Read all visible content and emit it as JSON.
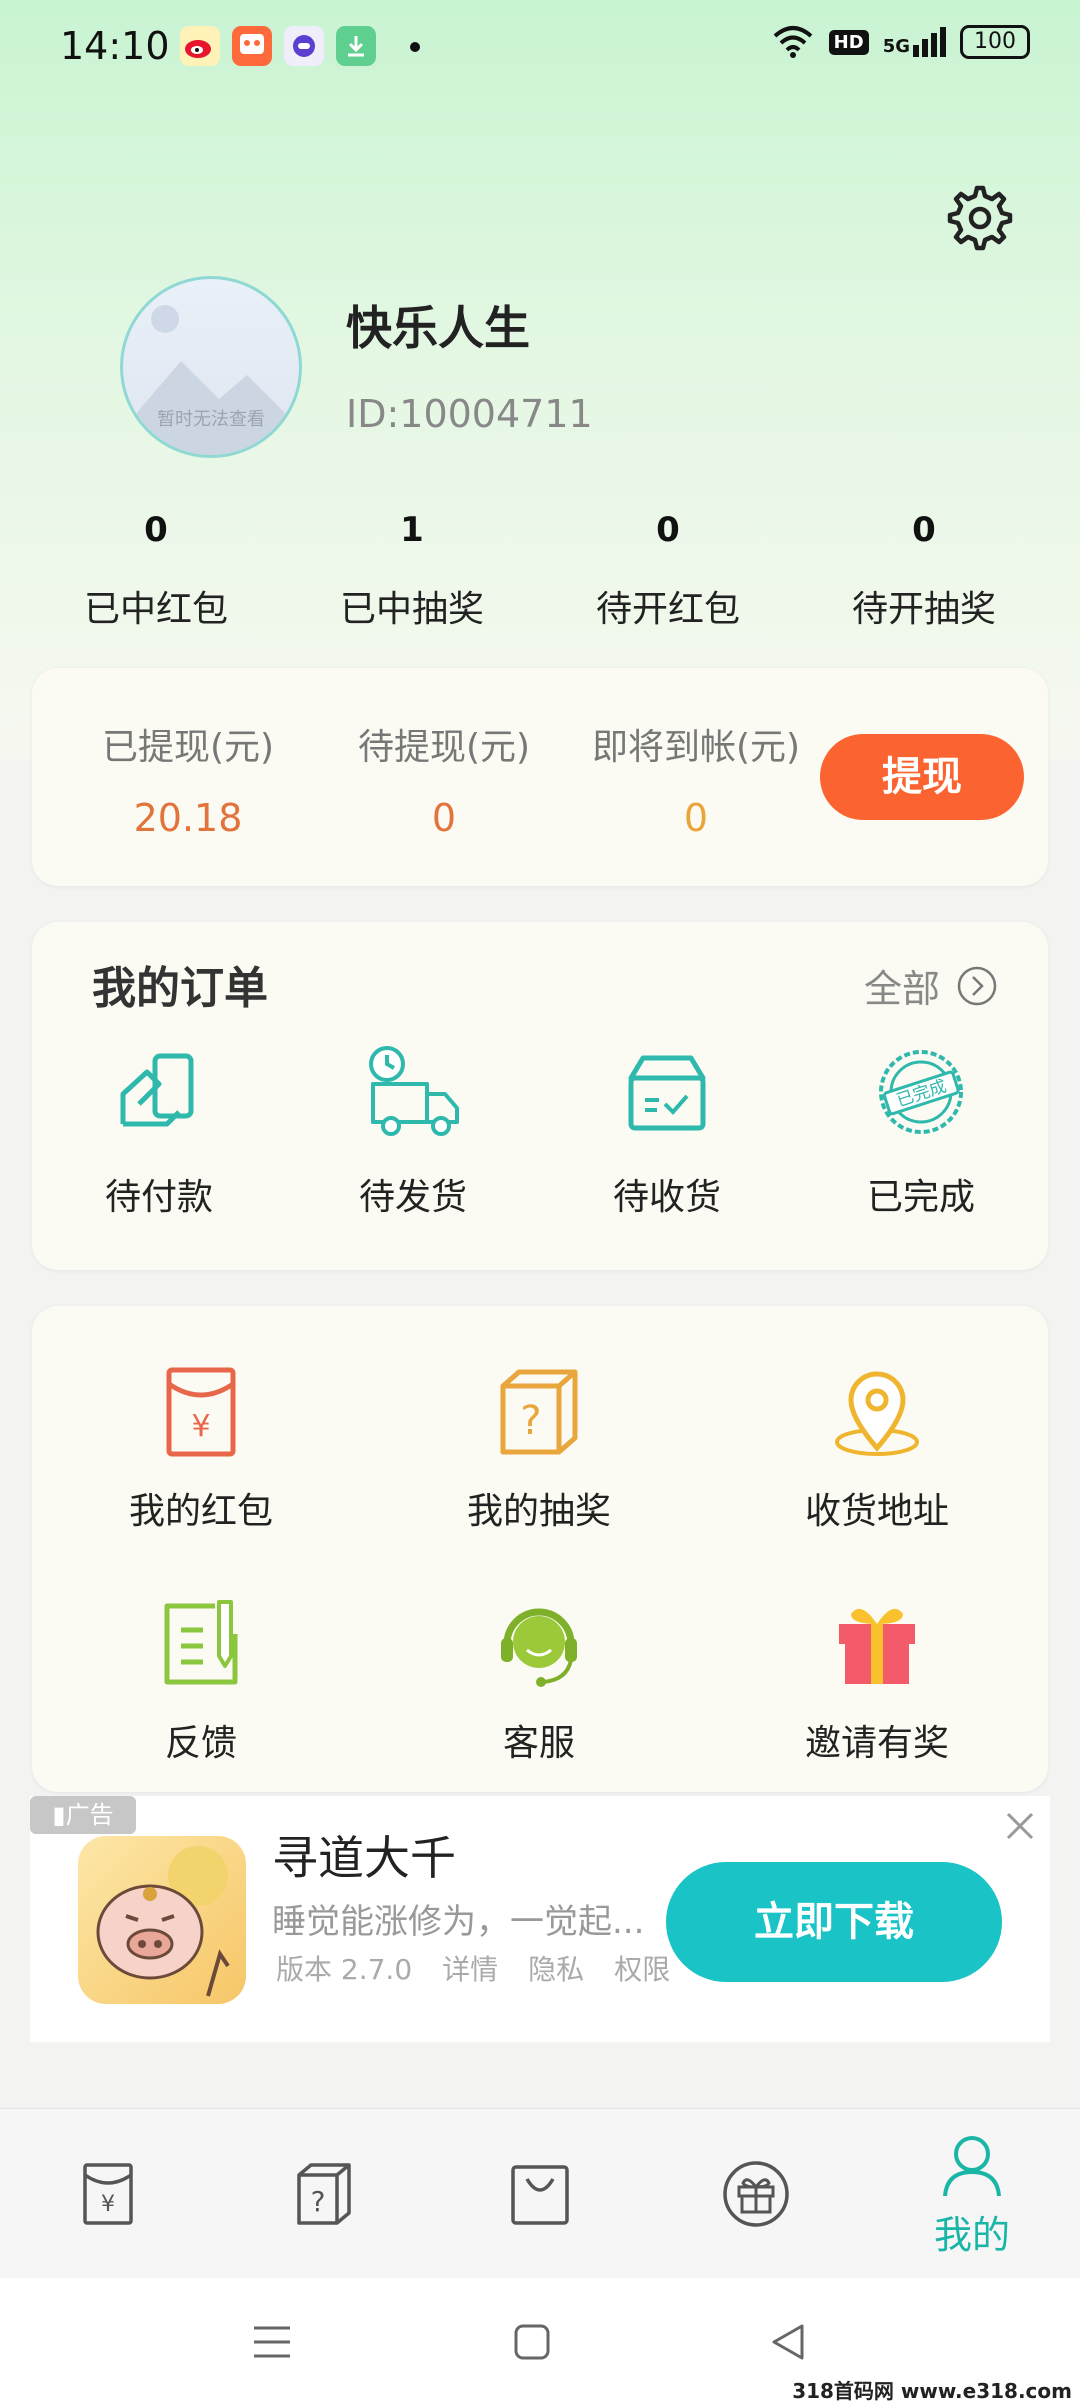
{
  "status_bar": {
    "time": "14:10",
    "hd": "HD",
    "network": "5G",
    "battery": "100"
  },
  "user": {
    "name": "快乐人生",
    "id": "ID:10004711",
    "avatar_text": "暂时无法查看"
  },
  "stats": [
    {
      "value": "0",
      "label": "已中红包"
    },
    {
      "value": "1",
      "label": "已中抽奖"
    },
    {
      "value": "0",
      "label": "待开红包"
    },
    {
      "value": "0",
      "label": "待开抽奖"
    }
  ],
  "wallet": {
    "items": [
      {
        "label": "已提现(元)",
        "value": "20.18",
        "color": "#e2733a"
      },
      {
        "label": "待提现(元)",
        "value": "0",
        "color": "#e2733a"
      },
      {
        "label": "即将到帐(元)",
        "value": "0",
        "color": "#e9a43a"
      }
    ],
    "button": "提现"
  },
  "orders": {
    "title": "我的订单",
    "all": "全部",
    "items": [
      {
        "label": "待付款",
        "icon": "payment-icon"
      },
      {
        "label": "待发货",
        "icon": "delivery-truck-icon"
      },
      {
        "label": "待收货",
        "icon": "receive-box-icon"
      },
      {
        "label": "已完成",
        "icon": "completed-stamp-icon",
        "stamp_text": "已完成"
      }
    ]
  },
  "services": [
    {
      "label": "我的红包",
      "icon": "red-envelope-icon"
    },
    {
      "label": "我的抽奖",
      "icon": "mystery-box-icon"
    },
    {
      "label": "收货地址",
      "icon": "location-pin-icon"
    },
    {
      "label": "反馈",
      "icon": "feedback-icon"
    },
    {
      "label": "客服",
      "icon": "customer-service-icon"
    },
    {
      "label": "邀请有奖",
      "icon": "gift-icon"
    }
  ],
  "ad": {
    "tag": "广告",
    "title": "寻道大千",
    "description": "睡觉能涨修为，一觉起...",
    "version": "版本 2.7.0",
    "details": "详情",
    "privacy": "隐私",
    "permissions": "权限",
    "button": "立即下载"
  },
  "bottom_nav": [
    {
      "icon": "red-envelope-icon",
      "label": ""
    },
    {
      "icon": "mystery-box-icon",
      "label": ""
    },
    {
      "icon": "shopping-bag-icon",
      "label": ""
    },
    {
      "icon": "gift-circle-icon",
      "label": ""
    },
    {
      "icon": "user-icon",
      "label": "我的",
      "active": true
    }
  ],
  "watermark": "318首码网 www.e318.com",
  "colors": {
    "accent": "#19b6a8",
    "withdraw": "#fb6430",
    "ad_button": "#19c3c6"
  }
}
